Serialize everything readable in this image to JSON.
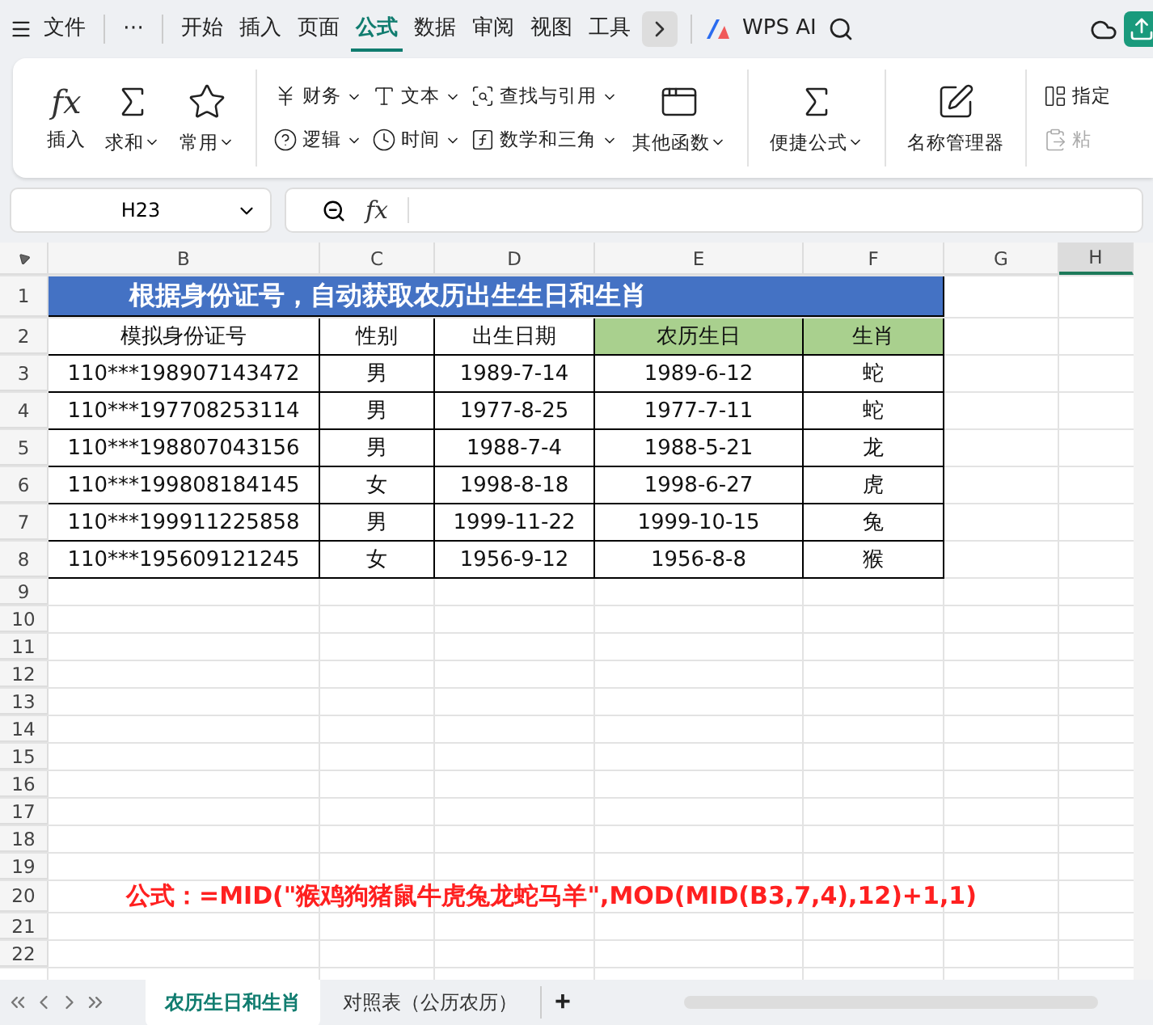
{
  "menu_bar": {
    "file_label": "文件",
    "more": "⋯",
    "tabs": [
      {
        "label": "开始",
        "selected": false
      },
      {
        "label": "插入",
        "selected": false
      },
      {
        "label": "页面",
        "selected": false
      },
      {
        "label": "公式",
        "selected": true
      },
      {
        "label": "数据",
        "selected": false
      },
      {
        "label": "审阅",
        "selected": false
      },
      {
        "label": "视图",
        "selected": false
      },
      {
        "label": "工具",
        "selected": false
      }
    ],
    "ai_label": "WPS AI"
  },
  "ribbon": {
    "groups": [
      {
        "kind": "large",
        "items": [
          {
            "symbol": "fx",
            "label": "插入",
            "dropdown": false
          },
          {
            "label": "求和",
            "dropdown": true
          },
          {
            "label": "常用",
            "dropdown": true
          }
        ]
      },
      {
        "kind": "small",
        "columns": [
          [
            {
              "label": "财务",
              "dropdown": true
            },
            {
              "label": "逻辑",
              "dropdown": true
            }
          ],
          [
            {
              "label": "文本",
              "dropdown": true
            },
            {
              "label": "时间",
              "dropdown": true
            }
          ],
          [
            {
              "label": "查找与引用",
              "dropdown": true
            },
            {
              "label": "数学和三角",
              "dropdown": true
            }
          ]
        ],
        "items": [
          {
            "label": "其他函数",
            "dropdown": true
          }
        ]
      },
      {
        "kind": "large",
        "items": [
          {
            "label": "便捷公式",
            "dropdown": true
          }
        ]
      },
      {
        "kind": "large",
        "items": [
          {
            "label": "名称管理器",
            "dropdown": false
          }
        ]
      },
      {
        "kind": "small",
        "columns": [
          [
            {
              "label": "指定",
              "dropdown": false,
              "disabled": false
            },
            {
              "label": "粘",
              "dropdown": false,
              "disabled": true
            }
          ]
        ]
      }
    ]
  },
  "formula_bar": {
    "name_box": "H23",
    "fx": "fx"
  },
  "sheet": {
    "columns": [
      {
        "label": "B",
        "selected": false
      },
      {
        "label": "C",
        "selected": false
      },
      {
        "label": "D",
        "selected": false
      },
      {
        "label": "E",
        "selected": false
      },
      {
        "label": "F",
        "selected": false
      },
      {
        "label": "G",
        "selected": false
      },
      {
        "label": "H",
        "selected": true
      }
    ],
    "rows": [
      {
        "number": "1",
        "kind": "title",
        "text": "根据身份证号，自动获取农历出生生日和生肖"
      },
      {
        "number": "2",
        "kind": "header",
        "cells": [
          {
            "text": "模拟身份证号",
            "highlighted": false
          },
          {
            "text": "性别",
            "highlighted": false
          },
          {
            "text": "出生日期",
            "highlighted": false
          },
          {
            "text": "农历生日",
            "highlighted": true
          },
          {
            "text": "生肖",
            "highlighted": true
          }
        ]
      },
      {
        "number": "3",
        "kind": "data",
        "cells": [
          "110***198907143472",
          "男",
          "1989-7-14",
          "1989-6-12",
          "蛇"
        ]
      },
      {
        "number": "4",
        "kind": "data",
        "cells": [
          "110***197708253114",
          "男",
          "1977-8-25",
          "1977-7-11",
          "蛇"
        ]
      },
      {
        "number": "5",
        "kind": "data",
        "cells": [
          "110***198807043156",
          "男",
          "1988-7-4",
          "1988-5-21",
          "龙"
        ]
      },
      {
        "number": "6",
        "kind": "data",
        "cells": [
          "110***199808184145",
          "女",
          "1998-8-18",
          "1998-6-27",
          "虎"
        ]
      },
      {
        "number": "7",
        "kind": "data",
        "cells": [
          "110***199911225858",
          "男",
          "1999-11-22",
          "1999-10-15",
          "兔"
        ]
      },
      {
        "number": "8",
        "kind": "data",
        "cells": [
          "110***195609121245",
          "女",
          "1956-9-12",
          "1956-8-8",
          "猴"
        ]
      },
      {
        "number": "9",
        "kind": "empty"
      },
      {
        "number": "10",
        "kind": "empty"
      },
      {
        "number": "11",
        "kind": "empty"
      },
      {
        "number": "12",
        "kind": "empty"
      },
      {
        "number": "13",
        "kind": "empty"
      },
      {
        "number": "14",
        "kind": "empty"
      },
      {
        "number": "15",
        "kind": "empty"
      },
      {
        "number": "16",
        "kind": "empty"
      },
      {
        "number": "17",
        "kind": "empty"
      },
      {
        "number": "18",
        "kind": "empty"
      },
      {
        "number": "19",
        "kind": "empty"
      },
      {
        "number": "20",
        "kind": "note",
        "text": "公式：=MID(\"猴鸡狗猪鼠牛虎兔龙蛇马羊\",MOD(MID(B3,7,4),12)+1,1)"
      },
      {
        "number": "21",
        "kind": "empty"
      },
      {
        "number": "22",
        "kind": "empty"
      }
    ]
  },
  "sheet_tabs": {
    "tabs": [
      {
        "label": "农历生日和生肖",
        "selected": true
      },
      {
        "label": "对照表（公历农历）",
        "selected": false
      }
    ],
    "add": "+"
  }
}
